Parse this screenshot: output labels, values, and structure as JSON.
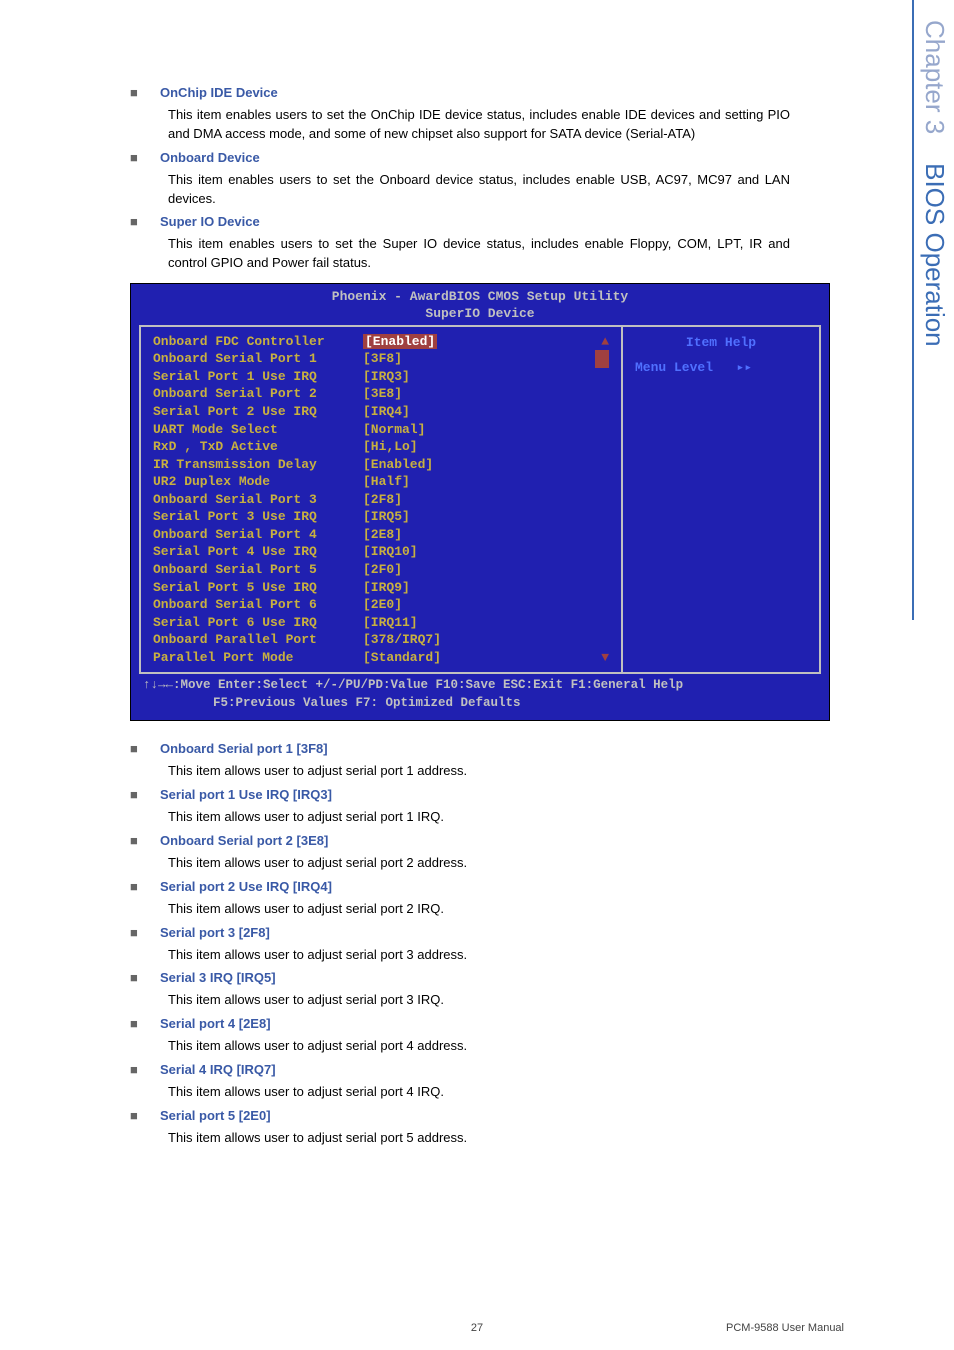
{
  "sideTab": {
    "chapter": "Chapter 3",
    "title": "BIOS Operation"
  },
  "sections_top": [
    {
      "title": "OnChip IDE Device",
      "body": "This item enables users to set the OnChip IDE device status, includes enable IDE devices and setting PIO and DMA access mode, and some of new chipset also support for SATA device (Serial-ATA)"
    },
    {
      "title": "Onboard Device",
      "body": "This item enables users to set the Onboard device status, includes enable USB, AC97, MC97 and LAN devices."
    },
    {
      "title": "Super IO Device",
      "body": "This item enables users to set the Super IO device status, includes enable Floppy, COM, LPT, IR and control GPIO and Power fail status."
    }
  ],
  "bios": {
    "header1": "Phoenix - AwardBIOS CMOS Setup Utility",
    "header2": "SuperIO Device",
    "helpTitle": "Item Help",
    "menuLevel": "Menu Level",
    "rows": [
      {
        "label": "Onboard FDC Controller",
        "value": "[Enabled]",
        "hl": true,
        "scroll": "▲"
      },
      {
        "label": "Onboard Serial Port 1",
        "value": "[3F8]",
        "scrollbar": true
      },
      {
        "label": "Serial Port 1 Use IRQ",
        "value": "[IRQ3]"
      },
      {
        "label": "Onboard Serial Port 2",
        "value": "[3E8]"
      },
      {
        "label": "Serial Port 2 Use IRQ",
        "value": "[IRQ4]"
      },
      {
        "label": "UART Mode Select",
        "value": "[Normal]"
      },
      {
        "label": "RxD , TxD Active",
        "value": "[Hi,Lo]"
      },
      {
        "label": "IR Transmission Delay",
        "value": "[Enabled]"
      },
      {
        "label": "UR2 Duplex Mode",
        "value": "[Half]"
      },
      {
        "label": "Onboard Serial Port 3",
        "value": "[2F8]"
      },
      {
        "label": "Serial Port 3 Use IRQ",
        "value": "[IRQ5]"
      },
      {
        "label": "Onboard Serial Port 4",
        "value": "[2E8]"
      },
      {
        "label": "Serial Port 4 Use IRQ",
        "value": "[IRQ10]"
      },
      {
        "label": "Onboard Serial Port 5",
        "value": "[2F0]"
      },
      {
        "label": "Serial Port 5 Use IRQ",
        "value": "[IRQ9]"
      },
      {
        "label": "Onboard Serial Port 6",
        "value": "[2E0]"
      },
      {
        "label": "Serial Port 6 Use IRQ",
        "value": "[IRQ11]"
      },
      {
        "label": "Onboard Parallel Port",
        "value": "[378/IRQ7]"
      },
      {
        "label": "Parallel Port Mode",
        "value": "[Standard]",
        "scroll": "▼"
      }
    ],
    "footer1": "↑↓→←:Move  Enter:Select  +/-/PU/PD:Value  F10:Save  ESC:Exit  F1:General Help",
    "footer2": "F5:Previous Values              F7: Optimized Defaults"
  },
  "sections_bottom": [
    {
      "title": "Onboard Serial port 1 [3F8]",
      "body": "This item allows user to adjust serial port 1 address."
    },
    {
      "title": "Serial port 1 Use IRQ [IRQ3]",
      "body": "This item allows user to adjust serial port 1 IRQ."
    },
    {
      "title": "Onboard Serial port 2 [3E8]",
      "body": "This item allows user to adjust serial port 2 address."
    },
    {
      "title": "Serial port 2 Use IRQ [IRQ4]",
      "body": "This item allows user to adjust serial port 2 IRQ."
    },
    {
      "title": "Serial port 3 [2F8]",
      "body": "This item allows user to adjust serial port 3 address."
    },
    {
      "title": "Serial 3 IRQ [IRQ5]",
      "body": "This item allows user to adjust serial port 3 IRQ."
    },
    {
      "title": "Serial port 4 [2E8]",
      "body": "This item allows user to adjust serial port 4 address."
    },
    {
      "title": "Serial 4 IRQ [IRQ7]",
      "body": "This item allows user to adjust serial port 4 IRQ."
    },
    {
      "title": "Serial port 5 [2E0]",
      "body": "This item allows user to adjust serial port 5 address."
    }
  ],
  "footer": {
    "page": "27",
    "manual": "PCM-9588 User Manual"
  }
}
